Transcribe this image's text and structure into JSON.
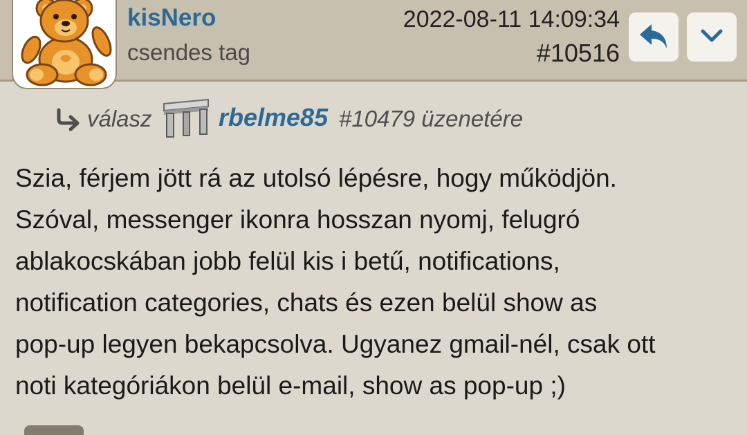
{
  "post": {
    "username": "kisNero",
    "rank": "csendes tag",
    "timestamp": "2022-08-11 14:09:34",
    "post_number": "#10516",
    "avatar_icon": "teddy-bear-icon"
  },
  "actions": {
    "reply_icon": "reply-arrow-icon",
    "more_icon": "chevron-down-icon"
  },
  "reply_to": {
    "prefix": "válasz",
    "username": "rbelme85",
    "ref_text": "#10479 üzenetére",
    "avatar_icon": "stool-icon"
  },
  "message": {
    "lines": [
      "Szia, férjem jött rá az utolsó lépésre, hogy működjön.",
      "Szóval, messenger ikonra hosszan nyomj, felugró",
      "ablakocskában jobb felül kis i betű, notifications,",
      "notification categories, chats és ezen belül show as",
      "pop-up legyen bekapcsolva. Ugyanez gmail-nél, csak ott",
      "noti kategóriákon belül e-mail, show as pop-up ;)"
    ]
  },
  "colors": {
    "header_bg": "#c8c0ae",
    "body_bg": "#ddd8cd",
    "link": "#2c6a95"
  }
}
